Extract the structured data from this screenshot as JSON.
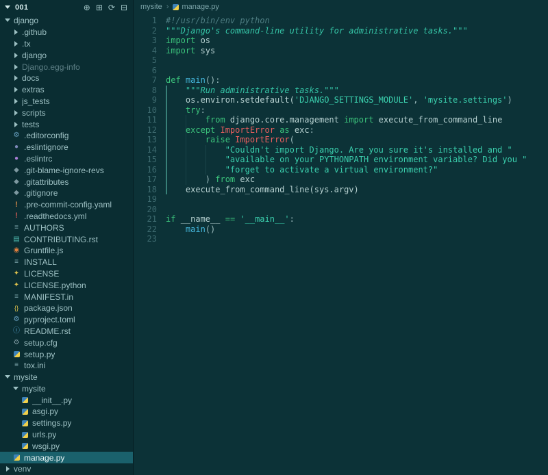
{
  "theme": {
    "editor_bg": "#0c3237",
    "sidebar_bg": "#0a2d32",
    "selection_bg": "#1a616c",
    "string_teal": "#3bd0ae",
    "keyword_green": "#3cc47c",
    "error_red": "#ea5f5f",
    "function_blue": "#45b7dc"
  },
  "explorer": {
    "title": "001",
    "actions": [
      {
        "name": "new-file-icon",
        "glyph": "⊕"
      },
      {
        "name": "new-folder-icon",
        "glyph": "⊞"
      },
      {
        "name": "refresh-icon",
        "glyph": "⟳"
      },
      {
        "name": "collapse-all-icon",
        "glyph": "⊟"
      }
    ],
    "items": [
      {
        "label": "django",
        "level": 0,
        "kind": "folder",
        "expanded": true
      },
      {
        "label": ".github",
        "level": 1,
        "kind": "folder",
        "expanded": false
      },
      {
        "label": ".tx",
        "level": 1,
        "kind": "folder",
        "expanded": false
      },
      {
        "label": "django",
        "level": 1,
        "kind": "folder",
        "expanded": false
      },
      {
        "label": "Django.egg-info",
        "level": 1,
        "kind": "folder",
        "expanded": false,
        "dim": true
      },
      {
        "label": "docs",
        "level": 1,
        "kind": "folder",
        "expanded": false
      },
      {
        "label": "extras",
        "level": 1,
        "kind": "folder",
        "expanded": false
      },
      {
        "label": "js_tests",
        "level": 1,
        "kind": "folder",
        "expanded": false
      },
      {
        "label": "scripts",
        "level": 1,
        "kind": "folder",
        "expanded": false
      },
      {
        "label": "tests",
        "level": 1,
        "kind": "folder",
        "expanded": false
      },
      {
        "label": ".editorconfig",
        "level": 1,
        "kind": "file",
        "icon": "gear-icon"
      },
      {
        "label": ".eslintignore",
        "level": 1,
        "kind": "file",
        "icon": "eslint-dim-icon"
      },
      {
        "label": ".eslintrc",
        "level": 1,
        "kind": "file",
        "icon": "eslint-icon"
      },
      {
        "label": ".git-blame-ignore-revs",
        "level": 1,
        "kind": "file",
        "icon": "git-icon"
      },
      {
        "label": ".gitattributes",
        "level": 1,
        "kind": "file",
        "icon": "git-icon"
      },
      {
        "label": ".gitignore",
        "level": 1,
        "kind": "file",
        "icon": "git-icon"
      },
      {
        "label": ".pre-commit-config.yaml",
        "level": 1,
        "kind": "file",
        "icon": "warning-orange-icon"
      },
      {
        "label": ".readthedocs.yml",
        "level": 1,
        "kind": "file",
        "icon": "warning-red-icon"
      },
      {
        "label": "AUTHORS",
        "level": 1,
        "kind": "file",
        "icon": "list-icon"
      },
      {
        "label": "CONTRIBUTING.rst",
        "level": 1,
        "kind": "file",
        "icon": "doc-icon"
      },
      {
        "label": "Gruntfile.js",
        "level": 1,
        "kind": "file",
        "icon": "grunt-icon"
      },
      {
        "label": "INSTALL",
        "level": 1,
        "kind": "file",
        "icon": "list-icon"
      },
      {
        "label": "LICENSE",
        "level": 1,
        "kind": "file",
        "icon": "key-icon"
      },
      {
        "label": "LICENSE.python",
        "level": 1,
        "kind": "file",
        "icon": "key-icon"
      },
      {
        "label": "MANIFEST.in",
        "level": 1,
        "kind": "file",
        "icon": "list-icon"
      },
      {
        "label": "package.json",
        "level": 1,
        "kind": "file",
        "icon": "json-icon"
      },
      {
        "label": "pyproject.toml",
        "level": 1,
        "kind": "file",
        "icon": "gear-icon"
      },
      {
        "label": "README.rst",
        "level": 1,
        "kind": "file",
        "icon": "info-icon"
      },
      {
        "label": "setup.cfg",
        "level": 1,
        "kind": "file",
        "icon": "gear-dim-icon"
      },
      {
        "label": "setup.py",
        "level": 1,
        "kind": "file",
        "icon": "python-icon"
      },
      {
        "label": "tox.ini",
        "level": 1,
        "kind": "file",
        "icon": "list-icon"
      },
      {
        "label": "mysite",
        "level": 0,
        "kind": "folder",
        "expanded": true
      },
      {
        "label": "mysite",
        "level": 1,
        "kind": "folder",
        "expanded": true
      },
      {
        "label": "__init__.py",
        "level": 2,
        "kind": "file",
        "icon": "python-icon"
      },
      {
        "label": "asgi.py",
        "level": 2,
        "kind": "file",
        "icon": "python-icon"
      },
      {
        "label": "settings.py",
        "level": 2,
        "kind": "file",
        "icon": "python-icon"
      },
      {
        "label": "urls.py",
        "level": 2,
        "kind": "file",
        "icon": "python-icon"
      },
      {
        "label": "wsgi.py",
        "level": 2,
        "kind": "file",
        "icon": "python-icon"
      },
      {
        "label": "manage.py",
        "level": 1,
        "kind": "file",
        "icon": "python-icon",
        "selected": true
      },
      {
        "label": "venv",
        "level": 0,
        "kind": "folder",
        "expanded": false
      }
    ]
  },
  "icons": {
    "gear-icon": {
      "glyph": "⚙",
      "color": "#6ea7c9"
    },
    "gear-dim-icon": {
      "glyph": "⚙",
      "color": "#7d98a0"
    },
    "eslint-icon": {
      "glyph": "●",
      "color": "#a97fd6"
    },
    "eslint-dim-icon": {
      "glyph": "●",
      "color": "#7d88b8"
    },
    "git-icon": {
      "glyph": "◆",
      "color": "#7d98a0"
    },
    "warning-orange-icon": {
      "glyph": "!",
      "color": "#d1884a"
    },
    "warning-red-icon": {
      "glyph": "!",
      "color": "#cc5a54"
    },
    "list-icon": {
      "glyph": "≡",
      "color": "#7fa6ad"
    },
    "doc-icon": {
      "glyph": "▤",
      "color": "#4db6ac"
    },
    "grunt-icon": {
      "glyph": "◉",
      "color": "#df7e3e"
    },
    "key-icon": {
      "glyph": "✦",
      "color": "#dec14d"
    },
    "json-icon": {
      "glyph": "{}",
      "color": "#dec14d"
    },
    "info-icon": {
      "glyph": "ⓘ",
      "color": "#5aa7d6"
    },
    "python-icon": {
      "glyph": "",
      "color": "two-tone-blue-yellow"
    }
  },
  "breadcrumb": {
    "separator": "›",
    "items": [
      {
        "label": "mysite"
      },
      {
        "label": "manage.py",
        "icon": "python-icon"
      }
    ]
  },
  "editor": {
    "file_language": "python",
    "indent_guides": [
      {
        "col": 0,
        "from": 8,
        "to": 18,
        "active": true
      },
      {
        "col": 4,
        "from": 11,
        "to": 17,
        "active": false
      },
      {
        "col": 8,
        "from": 14,
        "to": 16,
        "active": false
      }
    ],
    "lines": [
      [
        [
          "comment",
          "#!/usr/bin/env python"
        ]
      ],
      [
        [
          "docstring",
          "\"\"\"Django's command-line utility for administrative tasks.\"\"\""
        ]
      ],
      [
        [
          "keyword",
          "import "
        ],
        [
          "text",
          "os"
        ]
      ],
      [
        [
          "keyword",
          "import "
        ],
        [
          "text",
          "sys"
        ]
      ],
      [],
      [],
      [
        [
          "keyword",
          "def "
        ],
        [
          "func",
          "main"
        ],
        [
          "punct",
          "():"
        ]
      ],
      [
        [
          "docstring",
          "    \"\"\"Run administrative tasks.\"\"\""
        ]
      ],
      [
        [
          "text",
          "    os.environ.setdefault("
        ],
        [
          "string",
          "'DJANGO_SETTINGS_MODULE'"
        ],
        [
          "punct",
          ", "
        ],
        [
          "string",
          "'mysite.settings'"
        ],
        [
          "punct",
          ")"
        ]
      ],
      [
        [
          "indent",
          "    "
        ],
        [
          "keyword",
          "try"
        ],
        [
          "punct",
          ":"
        ]
      ],
      [
        [
          "indent",
          "        "
        ],
        [
          "keyword",
          "from "
        ],
        [
          "text",
          "django.core.management "
        ],
        [
          "keyword",
          "import "
        ],
        [
          "text",
          "execute_from_command_line"
        ]
      ],
      [
        [
          "indent",
          "    "
        ],
        [
          "keyword",
          "except "
        ],
        [
          "error",
          "ImportError"
        ],
        [
          "keyword",
          " as "
        ],
        [
          "text",
          "exc"
        ],
        [
          "punct",
          ":"
        ]
      ],
      [
        [
          "indent",
          "        "
        ],
        [
          "keyword",
          "raise "
        ],
        [
          "error",
          "ImportError"
        ],
        [
          "punct",
          "("
        ]
      ],
      [
        [
          "string",
          "            \"Couldn't import Django. Are you sure it's installed and \""
        ]
      ],
      [
        [
          "string",
          "            \"available on your PYTHONPATH environment variable? Did you \""
        ]
      ],
      [
        [
          "string",
          "            \"forget to activate a virtual environment?\""
        ]
      ],
      [
        [
          "punct",
          "        ) "
        ],
        [
          "keyword",
          "from "
        ],
        [
          "text",
          "exc"
        ]
      ],
      [
        [
          "text",
          "    execute_from_command_line(sys.argv)"
        ]
      ],
      [],
      [],
      [
        [
          "keyword",
          "if "
        ],
        [
          "text",
          "__name__ "
        ],
        [
          "operator",
          "== "
        ],
        [
          "string",
          "'__main__'"
        ],
        [
          "punct",
          ":"
        ]
      ],
      [
        [
          "indent",
          "    "
        ],
        [
          "func",
          "main"
        ],
        [
          "punct",
          "()"
        ]
      ],
      []
    ]
  }
}
